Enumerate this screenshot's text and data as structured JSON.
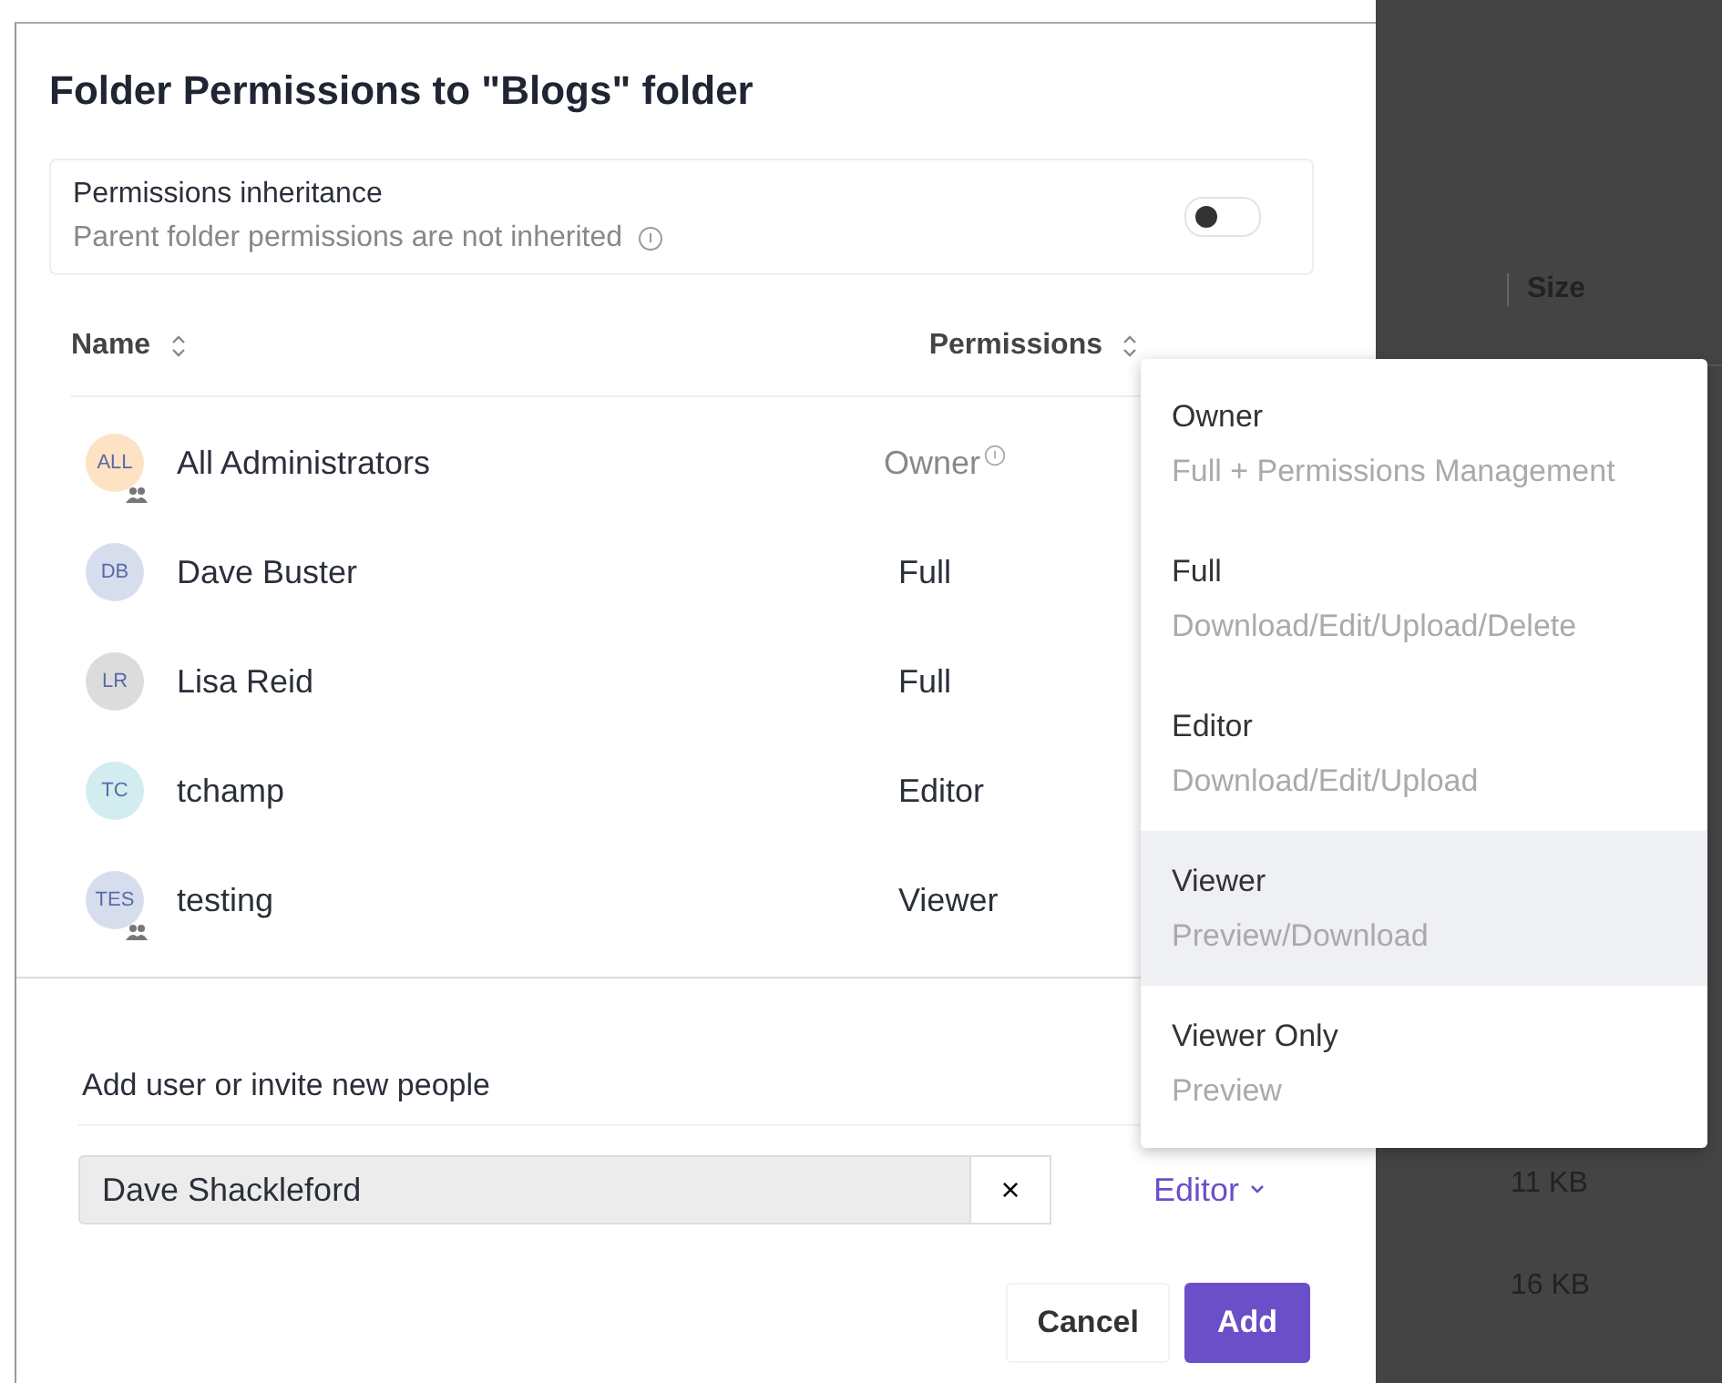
{
  "dialog": {
    "title": "Folder Permissions to \"Blogs\" folder",
    "inheritance": {
      "label": "Permissions inheritance",
      "description": "Parent folder permissions are not inherited",
      "on": false
    },
    "columns": [
      "Name",
      "Permissions"
    ],
    "members": [
      {
        "initials": "ALL",
        "name": "All Administrators",
        "permission": "Owner",
        "color": "#fde2c4",
        "group": true,
        "info": true
      },
      {
        "initials": "DB",
        "name": "Dave Buster",
        "permission": "Full",
        "color": "#d6deee",
        "group": false,
        "info": false
      },
      {
        "initials": "LR",
        "name": "Lisa Reid",
        "permission": "Full",
        "color": "#dcdcdc",
        "group": false,
        "info": false
      },
      {
        "initials": "TC",
        "name": "tchamp",
        "permission": "Editor",
        "color": "#d3ecef",
        "group": false,
        "info": false
      },
      {
        "initials": "TES",
        "name": "testing",
        "permission": "Viewer",
        "color": "#d6deee",
        "group": true,
        "info": false
      }
    ],
    "add_section": {
      "label": "Add user or invite new people",
      "value": "Dave Shackleford",
      "clear": "×",
      "permission": "Editor",
      "buttons": [
        "Cancel",
        "Add"
      ]
    }
  },
  "background": {
    "column": "Size",
    "sizes": [
      "11 KB",
      "16 KB"
    ]
  },
  "permission_menu": [
    {
      "title": "Owner",
      "description": "Full + Permissions Management",
      "selected": false
    },
    {
      "title": "Full",
      "description": "Download/Edit/Upload/Delete",
      "selected": false
    },
    {
      "title": "Editor",
      "description": "Download/Edit/Upload",
      "selected": false
    },
    {
      "title": "Viewer",
      "description": "Preview/Download",
      "selected": true
    },
    {
      "title": "Viewer Only",
      "description": "Preview",
      "selected": false
    }
  ]
}
